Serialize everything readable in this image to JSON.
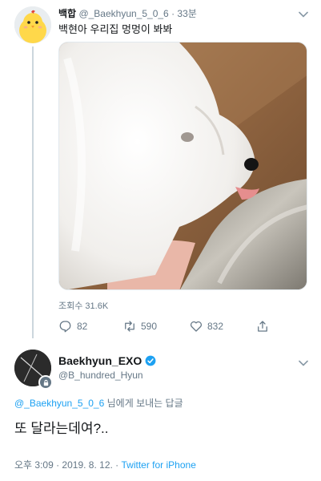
{
  "tweet": {
    "display_name": "백합",
    "handle": "@_Baekhyun_5_0_6",
    "separator": "·",
    "time_ago": "33분",
    "text": "백현아 우리집 멍멍이 봐봐",
    "view_count": "조회수 31.6K",
    "replies": "82",
    "retweets": "590",
    "likes": "832",
    "icons": [
      "chevron-down-icon",
      "reply-icon",
      "retweet-icon",
      "like-icon",
      "share-icon"
    ]
  },
  "reply": {
    "display_name": "Baekhyun_EXO",
    "handle": "@B_hundred_Hyun",
    "replying_to_handle": "@_Baekhyun_5_0_6",
    "replying_to_suffix": " 님에게 보내는 답글",
    "text": "또 달라는데여?..",
    "timestamp": "오후 3:09 · 2019. 8. 12. · ",
    "source": "Twitter for iPhone",
    "icons": [
      "verified-badge-icon",
      "chevron-down-icon",
      "locked-badge-icon"
    ]
  },
  "colors": {
    "link_blue": "#1da1f2",
    "secondary_gray": "#657786",
    "thread_line": "#ccd6dd"
  }
}
